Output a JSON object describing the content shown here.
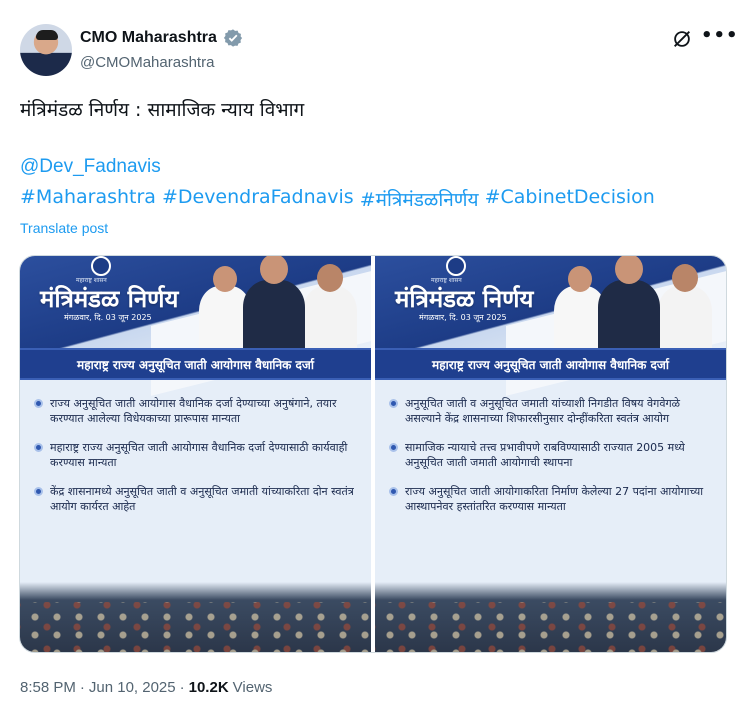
{
  "author": {
    "display_name": "CMO Maharashtra",
    "handle": "@CMOMaharashtra"
  },
  "tweet": {
    "text": "मंत्रिमंडळ निर्णय : सामाजिक न्याय विभाग",
    "mention": "@Dev_Fadnavis",
    "hashtags": [
      "#Maharashtra",
      "#DevendraFadnavis",
      "#मंत्रिमंडळनिर्णय",
      "#CabinetDecision"
    ],
    "translate_label": "Translate post"
  },
  "media": [
    {
      "emblem_text": "महाराष्ट्र शासन",
      "title": "मंत्रिमंडळ निर्णय",
      "date": "मंगळवार, दि. 03 जून 2025",
      "subject": "महाराष्ट्र राज्य अनुसूचित जाती आयोगास वैधानिक दर्जा",
      "points": [
        "राज्य अनुसूचित जाती आयोगास वैधानिक दर्जा देण्याच्या अनुषंगाने, तयार करण्यात आलेल्या विधेयकाच्या प्रारूपास मान्यता",
        "महाराष्ट्र राज्य अनुसूचित जाती आयोगास वैधानिक दर्जा देण्यासाठी कार्यवाही करण्यास मान्यता",
        "केंद्र शासनामध्ये अनुसूचित जाती व अनुसूचित जमाती यांच्याकरिता दोन स्वतंत्र आयोग कार्यरत आहेत"
      ]
    },
    {
      "emblem_text": "महाराष्ट्र शासन",
      "title": "मंत्रिमंडळ निर्णय",
      "date": "मंगळवार, दि. 03 जून 2025",
      "subject": "महाराष्ट्र राज्य अनुसूचित जाती आयोगास वैधानिक दर्जा",
      "points": [
        "अनुसूचित जाती व अनुसूचित जमाती यांच्याशी निगडीत विषय वेगवेगळे असल्याने केंद्र शासनाच्या शिफारसीनुसार दोन्हींकरिता स्वतंत्र आयोग",
        "सामाजिक न्यायाचे तत्त्व प्रभावीपणे राबविण्यासाठी राज्यात 2005 मध्ये अनुसूचित जाती जमाती आयोगाची स्थापना",
        "राज्य अनुसूचित जाती आयोगाकरिता निर्माण केलेल्या 27 पदांना आयोगाच्या आस्थापनेवर हस्तांतरित करण्यास मान्यता"
      ]
    }
  ],
  "meta": {
    "time": "8:58 PM",
    "separator": "·",
    "date": "Jun 10, 2025",
    "views_count": "10.2K",
    "views_label": "Views"
  },
  "icons": {
    "verified": "verified-badge-icon",
    "grok": "grok-icon",
    "more": "more-icon"
  },
  "colors": {
    "link": "#1d9bf0",
    "secondary_text": "#536471",
    "card_blue": "#1f3f8f"
  }
}
